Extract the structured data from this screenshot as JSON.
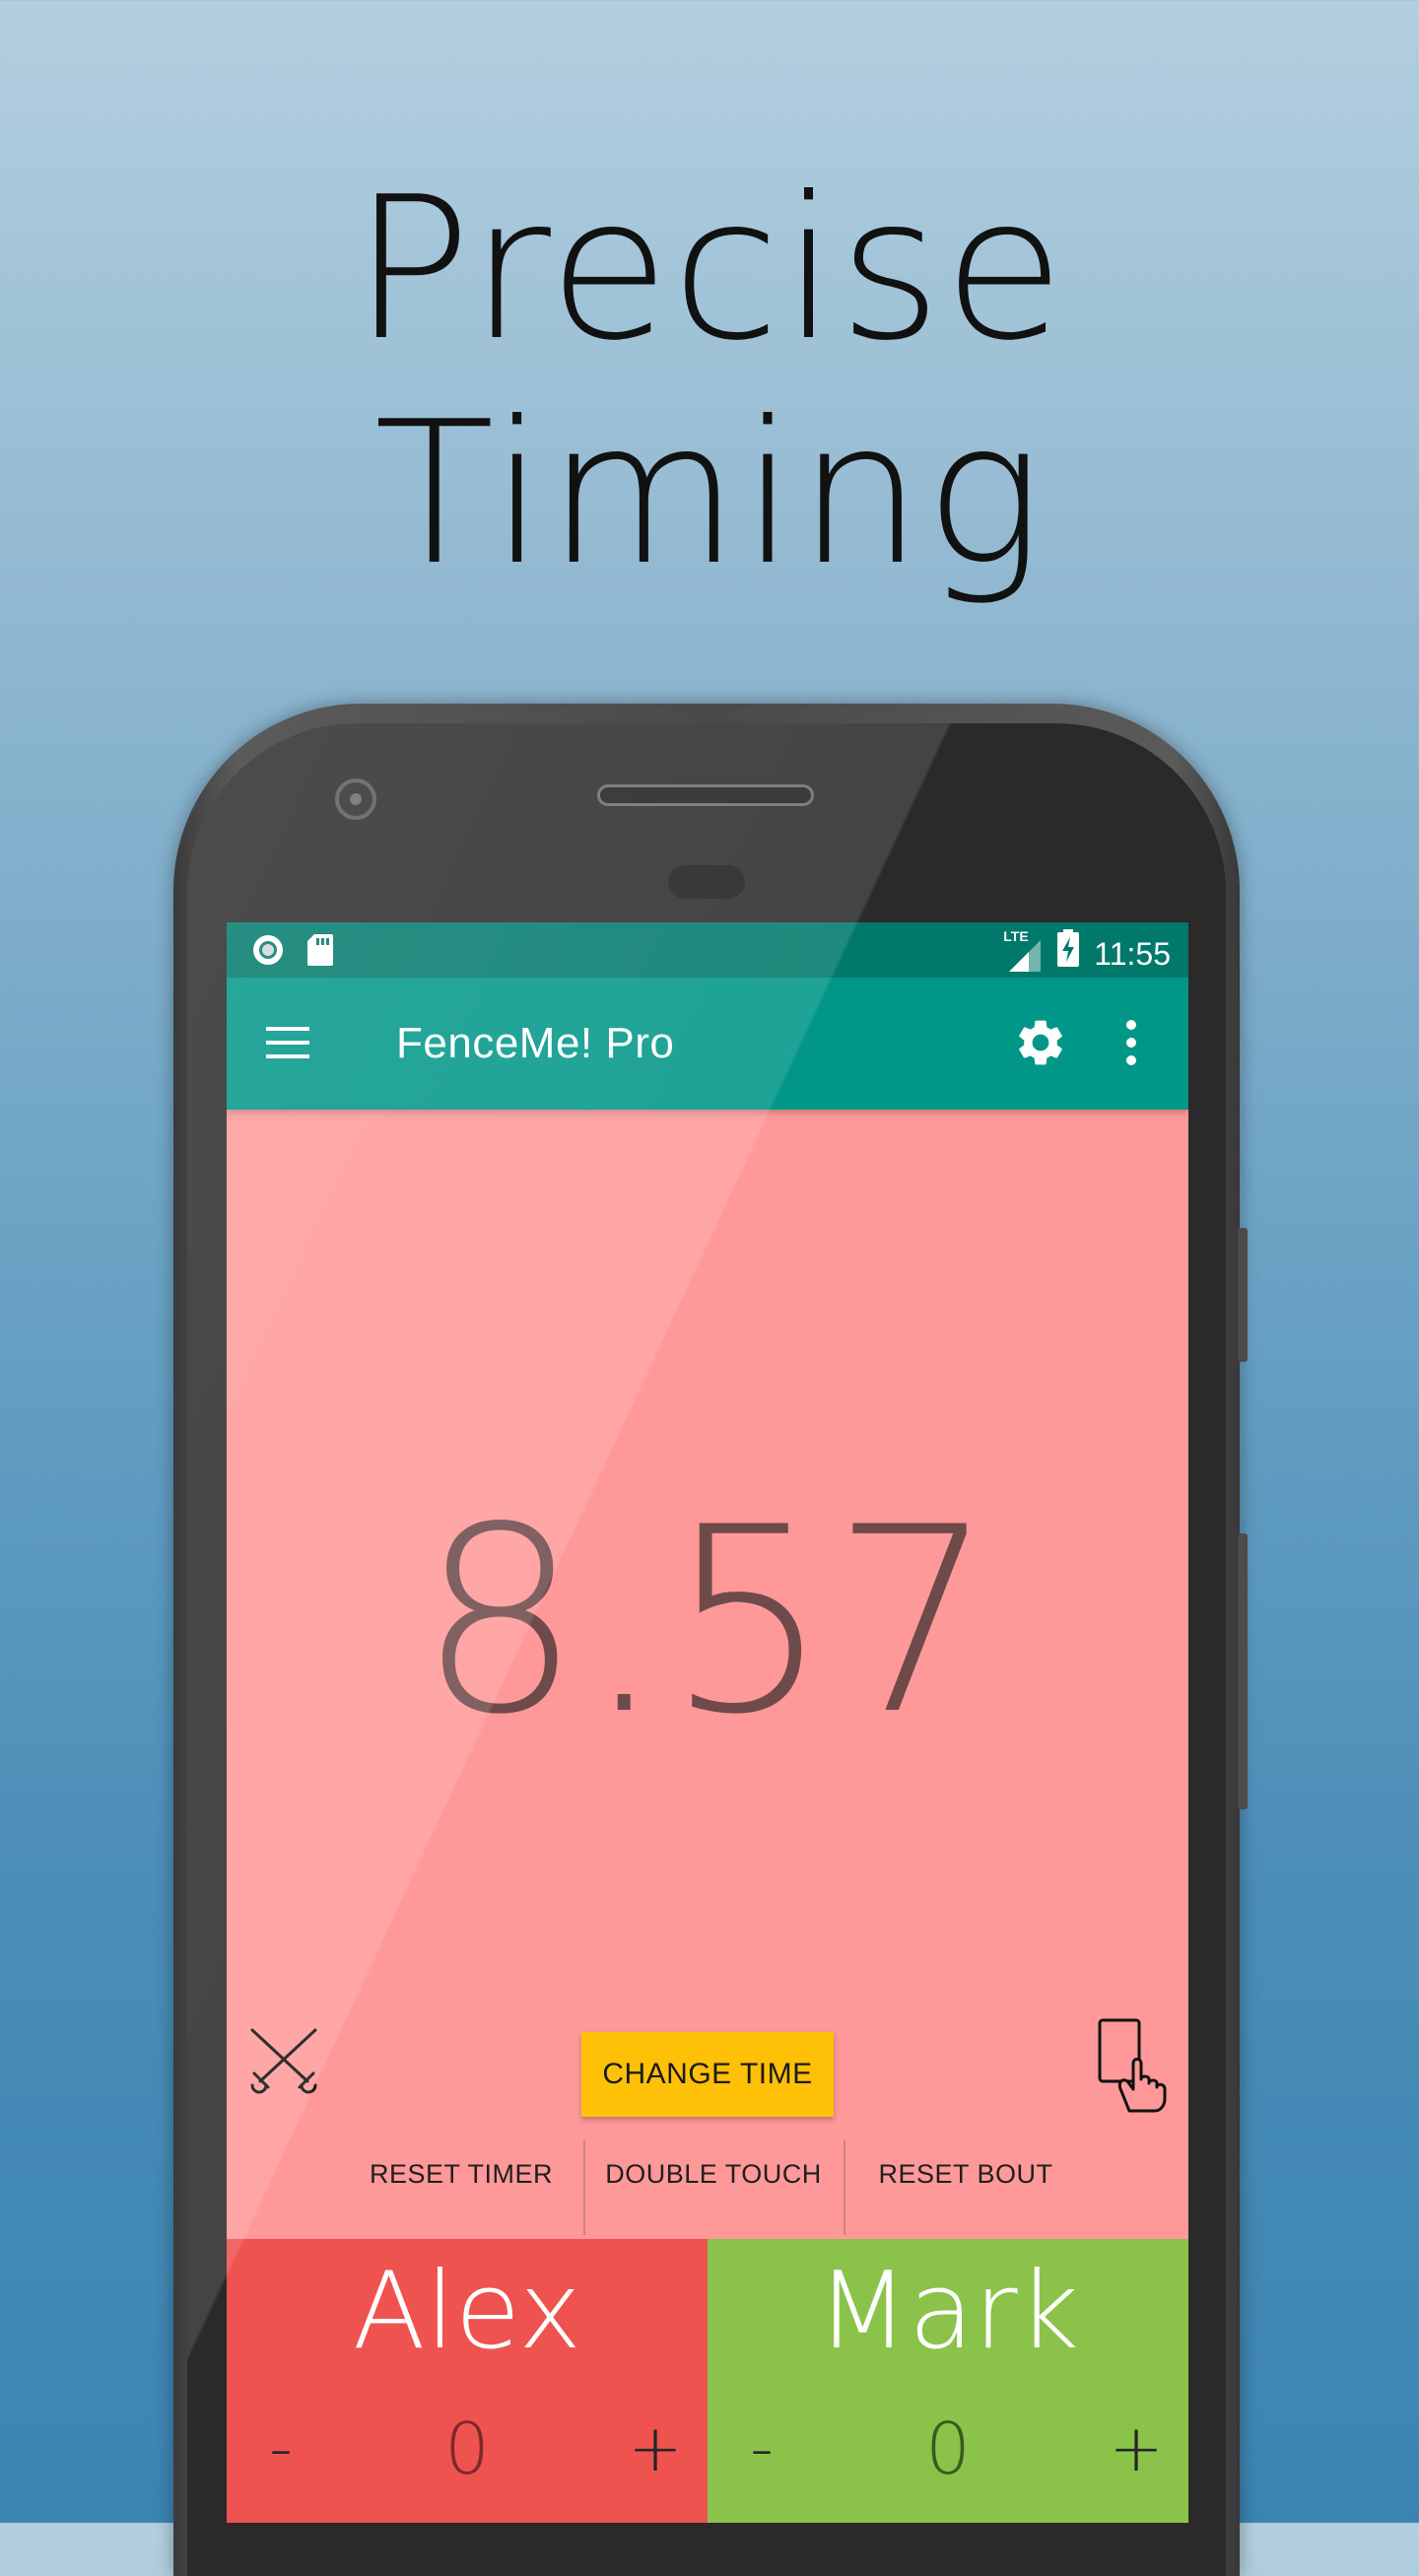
{
  "headline": {
    "line1": "Precise",
    "line2": "Timing"
  },
  "status_bar": {
    "network": "LTE",
    "time": "11:55",
    "icons": [
      "notification-circle-icon",
      "sd-card-icon",
      "signal-icon",
      "battery-charging-icon"
    ]
  },
  "app_bar": {
    "title": "FenceMe! Pro",
    "icons": [
      "menu-icon",
      "gear-icon",
      "more-vert-icon"
    ]
  },
  "timer": {
    "value": "8.57"
  },
  "controls": {
    "change_time_label": "CHANGE TIME",
    "actions": [
      "RESET TIMER",
      "DOUBLE TOUCH",
      "RESET BOUT"
    ],
    "left_icon": "crossed-swords-icon",
    "right_icon": "penalty-card-icon"
  },
  "players": [
    {
      "name": "Alex",
      "score": "0",
      "minus": "-",
      "plus": "+",
      "color": "#ef5350"
    },
    {
      "name": "Mark",
      "score": "0",
      "minus": "-",
      "plus": "+",
      "color": "#8bc34a"
    }
  ],
  "colors": {
    "background_top": "#b3cfdf",
    "background_bottom": "#3b84b2",
    "status_bar": "#00796b",
    "app_bar": "#009688",
    "screen_bg": "#ff9999",
    "accent_button": "#ffc107"
  }
}
